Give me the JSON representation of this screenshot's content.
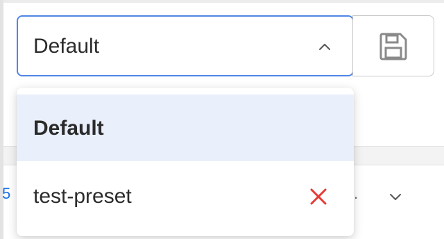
{
  "preset_select": {
    "value": "Default",
    "chevron_icon": "chevron-up-icon",
    "border_color": "#4f86e7"
  },
  "save_button": {
    "icon": "save-icon"
  },
  "dropdown": {
    "options": [
      {
        "label": "Default",
        "selected": true,
        "deletable": false
      },
      {
        "label": "test-preset",
        "selected": false,
        "deletable": true
      }
    ],
    "delete_icon": "close-icon",
    "delete_color": "#e53935",
    "selected_bg": "#e9f0fb"
  },
  "background_row": {
    "link_fragment": "5",
    "trailing_text": ".",
    "chevron_icon": "chevron-down-icon",
    "link_color": "#1a73e8"
  }
}
